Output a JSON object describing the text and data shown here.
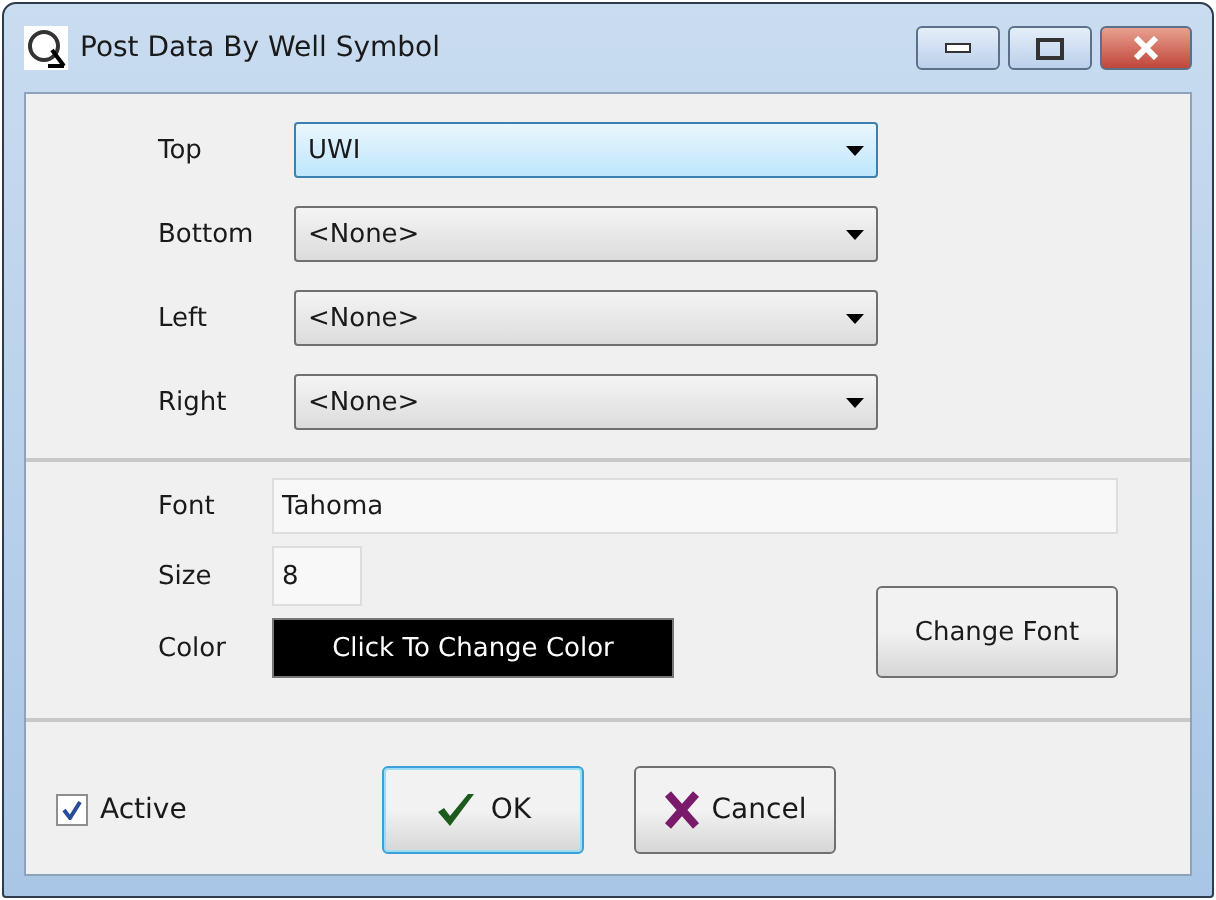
{
  "window": {
    "title": "Post Data By Well Symbol"
  },
  "positions": [
    {
      "label": "Top",
      "value": "UWI",
      "focused": true
    },
    {
      "label": "Bottom",
      "value": "<None>",
      "focused": false
    },
    {
      "label": "Left",
      "value": "<None>",
      "focused": false
    },
    {
      "label": "Right",
      "value": "<None>",
      "focused": false
    }
  ],
  "font": {
    "font_label": "Font",
    "font_value": "Tahoma",
    "size_label": "Size",
    "size_value": "8",
    "color_label": "Color",
    "color_button": "Click To Change Color",
    "change_button": "Change Font"
  },
  "active": {
    "label": "Active",
    "checked": true
  },
  "buttons": [
    {
      "kind": "ok",
      "label": "OK",
      "focused": true
    },
    {
      "kind": "cancel",
      "label": "Cancel",
      "focused": false
    }
  ]
}
